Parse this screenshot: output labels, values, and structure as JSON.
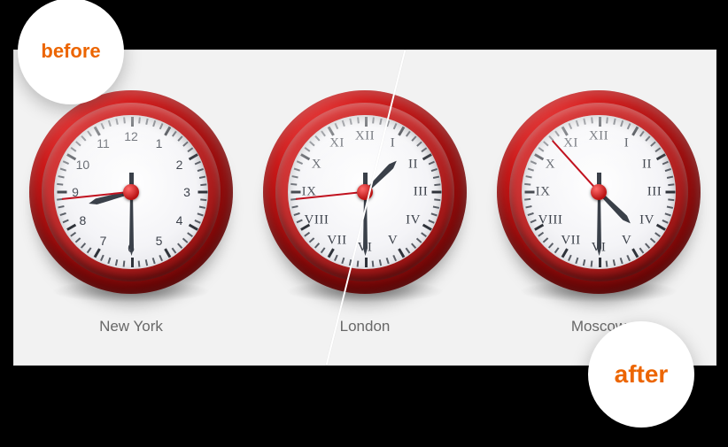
{
  "badges": {
    "before": "before",
    "after": "after"
  },
  "clocks": [
    {
      "city": "New York",
      "numeral_style": "arabic",
      "time": {
        "hour": 8,
        "minute": 30,
        "second": 44
      },
      "numerals": [
        "12",
        "1",
        "2",
        "3",
        "4",
        "5",
        "6",
        "7",
        "8",
        "9",
        "10",
        "11"
      ]
    },
    {
      "city": "London",
      "numeral_style": "roman",
      "time": {
        "hour": 1,
        "minute": 30,
        "second": 44
      },
      "numerals": [
        "XII",
        "I",
        "II",
        "III",
        "IV",
        "V",
        "VI",
        "VII",
        "VIII",
        "IX",
        "X",
        "XI"
      ]
    },
    {
      "city": "Moscow",
      "numeral_style": "roman",
      "time": {
        "hour": 4,
        "minute": 30,
        "second": 53
      },
      "numerals": [
        "XII",
        "I",
        "II",
        "III",
        "IV",
        "V",
        "VI",
        "VII",
        "VIII",
        "IX",
        "X",
        "XI"
      ]
    }
  ],
  "colors": {
    "accent": "#ec6500",
    "clock_rim": "#b81111",
    "second_hand": "#c1121f"
  }
}
